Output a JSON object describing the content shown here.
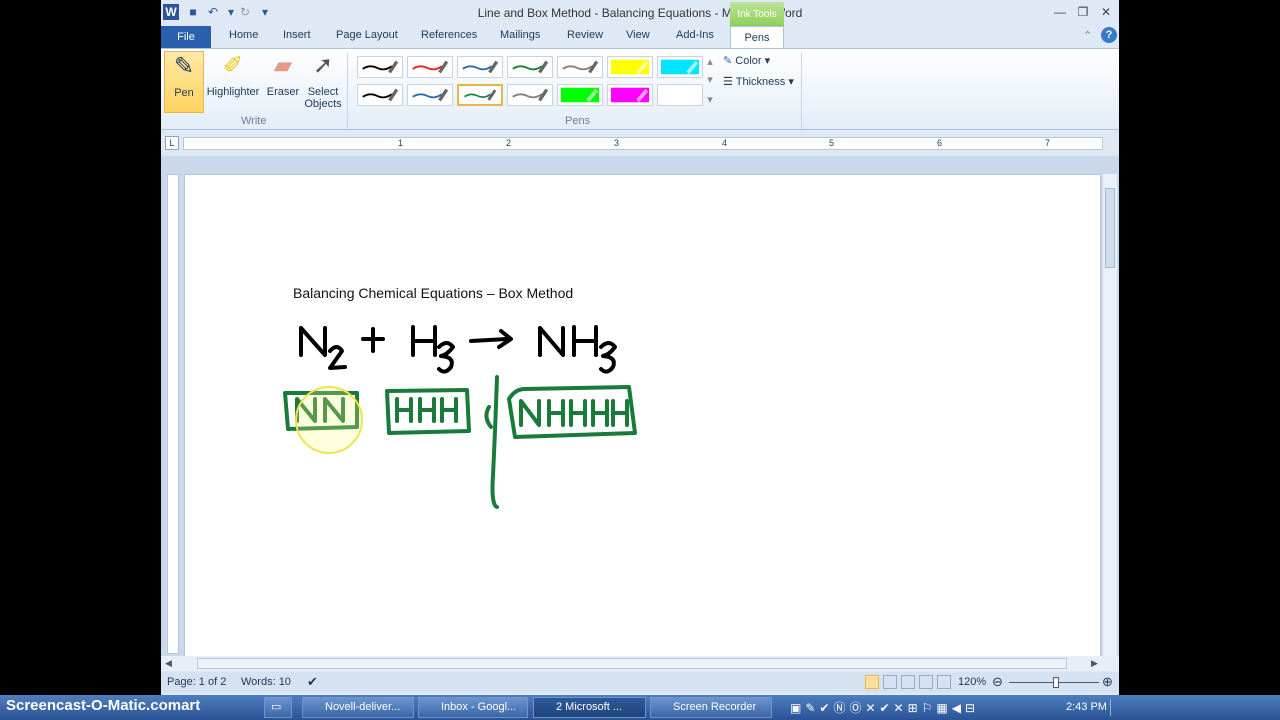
{
  "window": {
    "title": "Line and Box Method - Balancing Equations  -  Microsoft Word",
    "context_tab": "Ink Tools"
  },
  "tabs": [
    "File",
    "Home",
    "Insert",
    "Page Layout",
    "References",
    "Mailings",
    "Review",
    "View",
    "Add-Ins",
    "Pens"
  ],
  "ribbon": {
    "write_group": {
      "label": "Write",
      "buttons": [
        "Pen",
        "Highlighter",
        "Eraser",
        "Select Objects"
      ]
    },
    "pens_group": {
      "label": "Pens"
    },
    "color_label": "Color",
    "thickness_label": "Thickness"
  },
  "pen_colors": [
    "#000000",
    "#e02020",
    "#2b6cb0",
    "#1a7f3a",
    "#808080",
    "#ffff00",
    "#00e5ff",
    "#000000",
    "#2b6cb0",
    "#1a7f3a",
    "#808080",
    "#00ff00",
    "#ff00ff"
  ],
  "ruler_numbers": [
    "1",
    "2",
    "3",
    "4",
    "5",
    "6",
    "7"
  ],
  "document": {
    "heading": "Balancing Chemical Equations – Box Method",
    "ink_equation": "N₂ + H₃ → NH₃",
    "ink_boxes": [
      "NN",
      "HHH",
      "NHHH"
    ]
  },
  "status": {
    "page": "Page: 1 of 2",
    "words": "Words: 10",
    "zoom": "120%"
  },
  "taskbar": {
    "watermark": "Screencast-O-Matic.com",
    "start": "art",
    "items": [
      "Novell-deliver...",
      "Inbox - Googl...",
      "2 Microsoft ...",
      "Screen Recorder"
    ],
    "clock": "2:43 PM"
  }
}
